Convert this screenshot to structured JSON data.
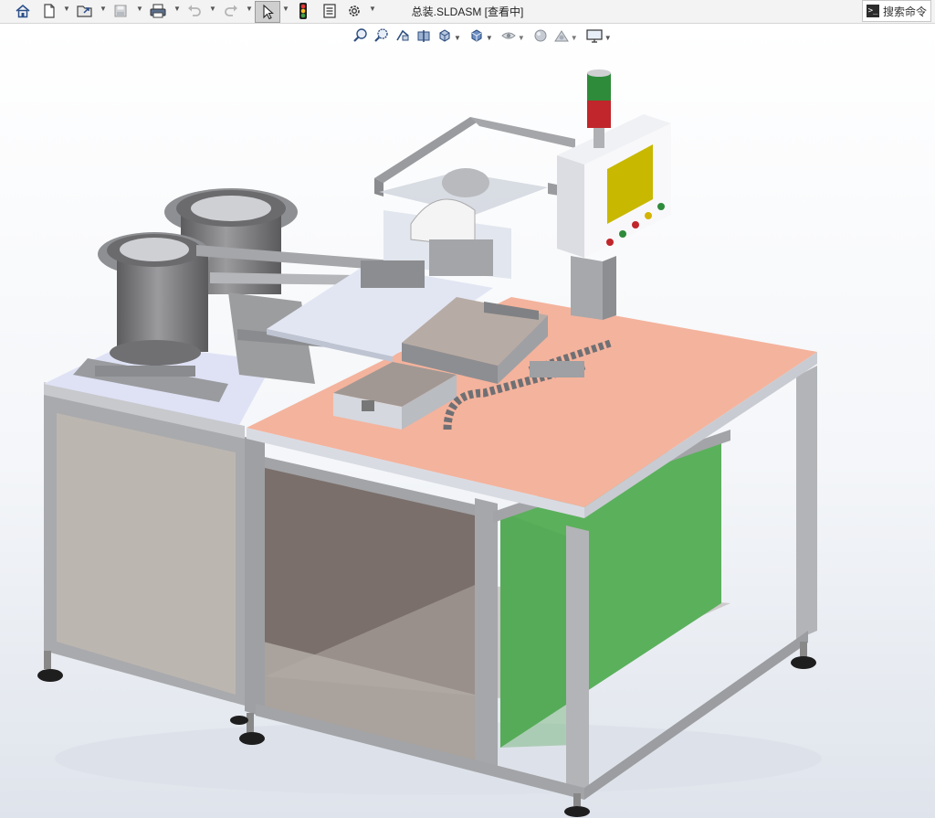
{
  "titlebar": {
    "document_title": "总装.SLDASM [查看中]",
    "search_label": "搜索命令",
    "search_prompt_glyph": ">_"
  },
  "toolbar": {
    "icons": [
      "home-icon",
      "new-document-icon",
      "open-folder-icon",
      "save-icon",
      "print-icon",
      "undo-icon",
      "redo-icon",
      "select-arrow-icon",
      "traffic-light-icon",
      "file-properties-icon",
      "options-gear-icon"
    ]
  },
  "heads_up_toolbar": {
    "icons": [
      "zoom-to-fit-icon",
      "zoom-to-area-icon",
      "previous-view-icon",
      "section-view-icon",
      "view-orientation-icon",
      "display-style-icon",
      "hide-show-items-icon",
      "edit-appearance-icon",
      "apply-scene-icon",
      "view-settings-icon"
    ]
  },
  "colors": {
    "table_top_pink": "#f4b39d",
    "table_top_lavender": "#dfe2f5",
    "frame_gray": "#a9aaad",
    "panel_green": "#5bb05c",
    "panel_taupe": "#bcb6b1",
    "hmi_screen": "#c8b800",
    "tower_green": "#2e8b3a",
    "tower_red": "#c0262b"
  }
}
